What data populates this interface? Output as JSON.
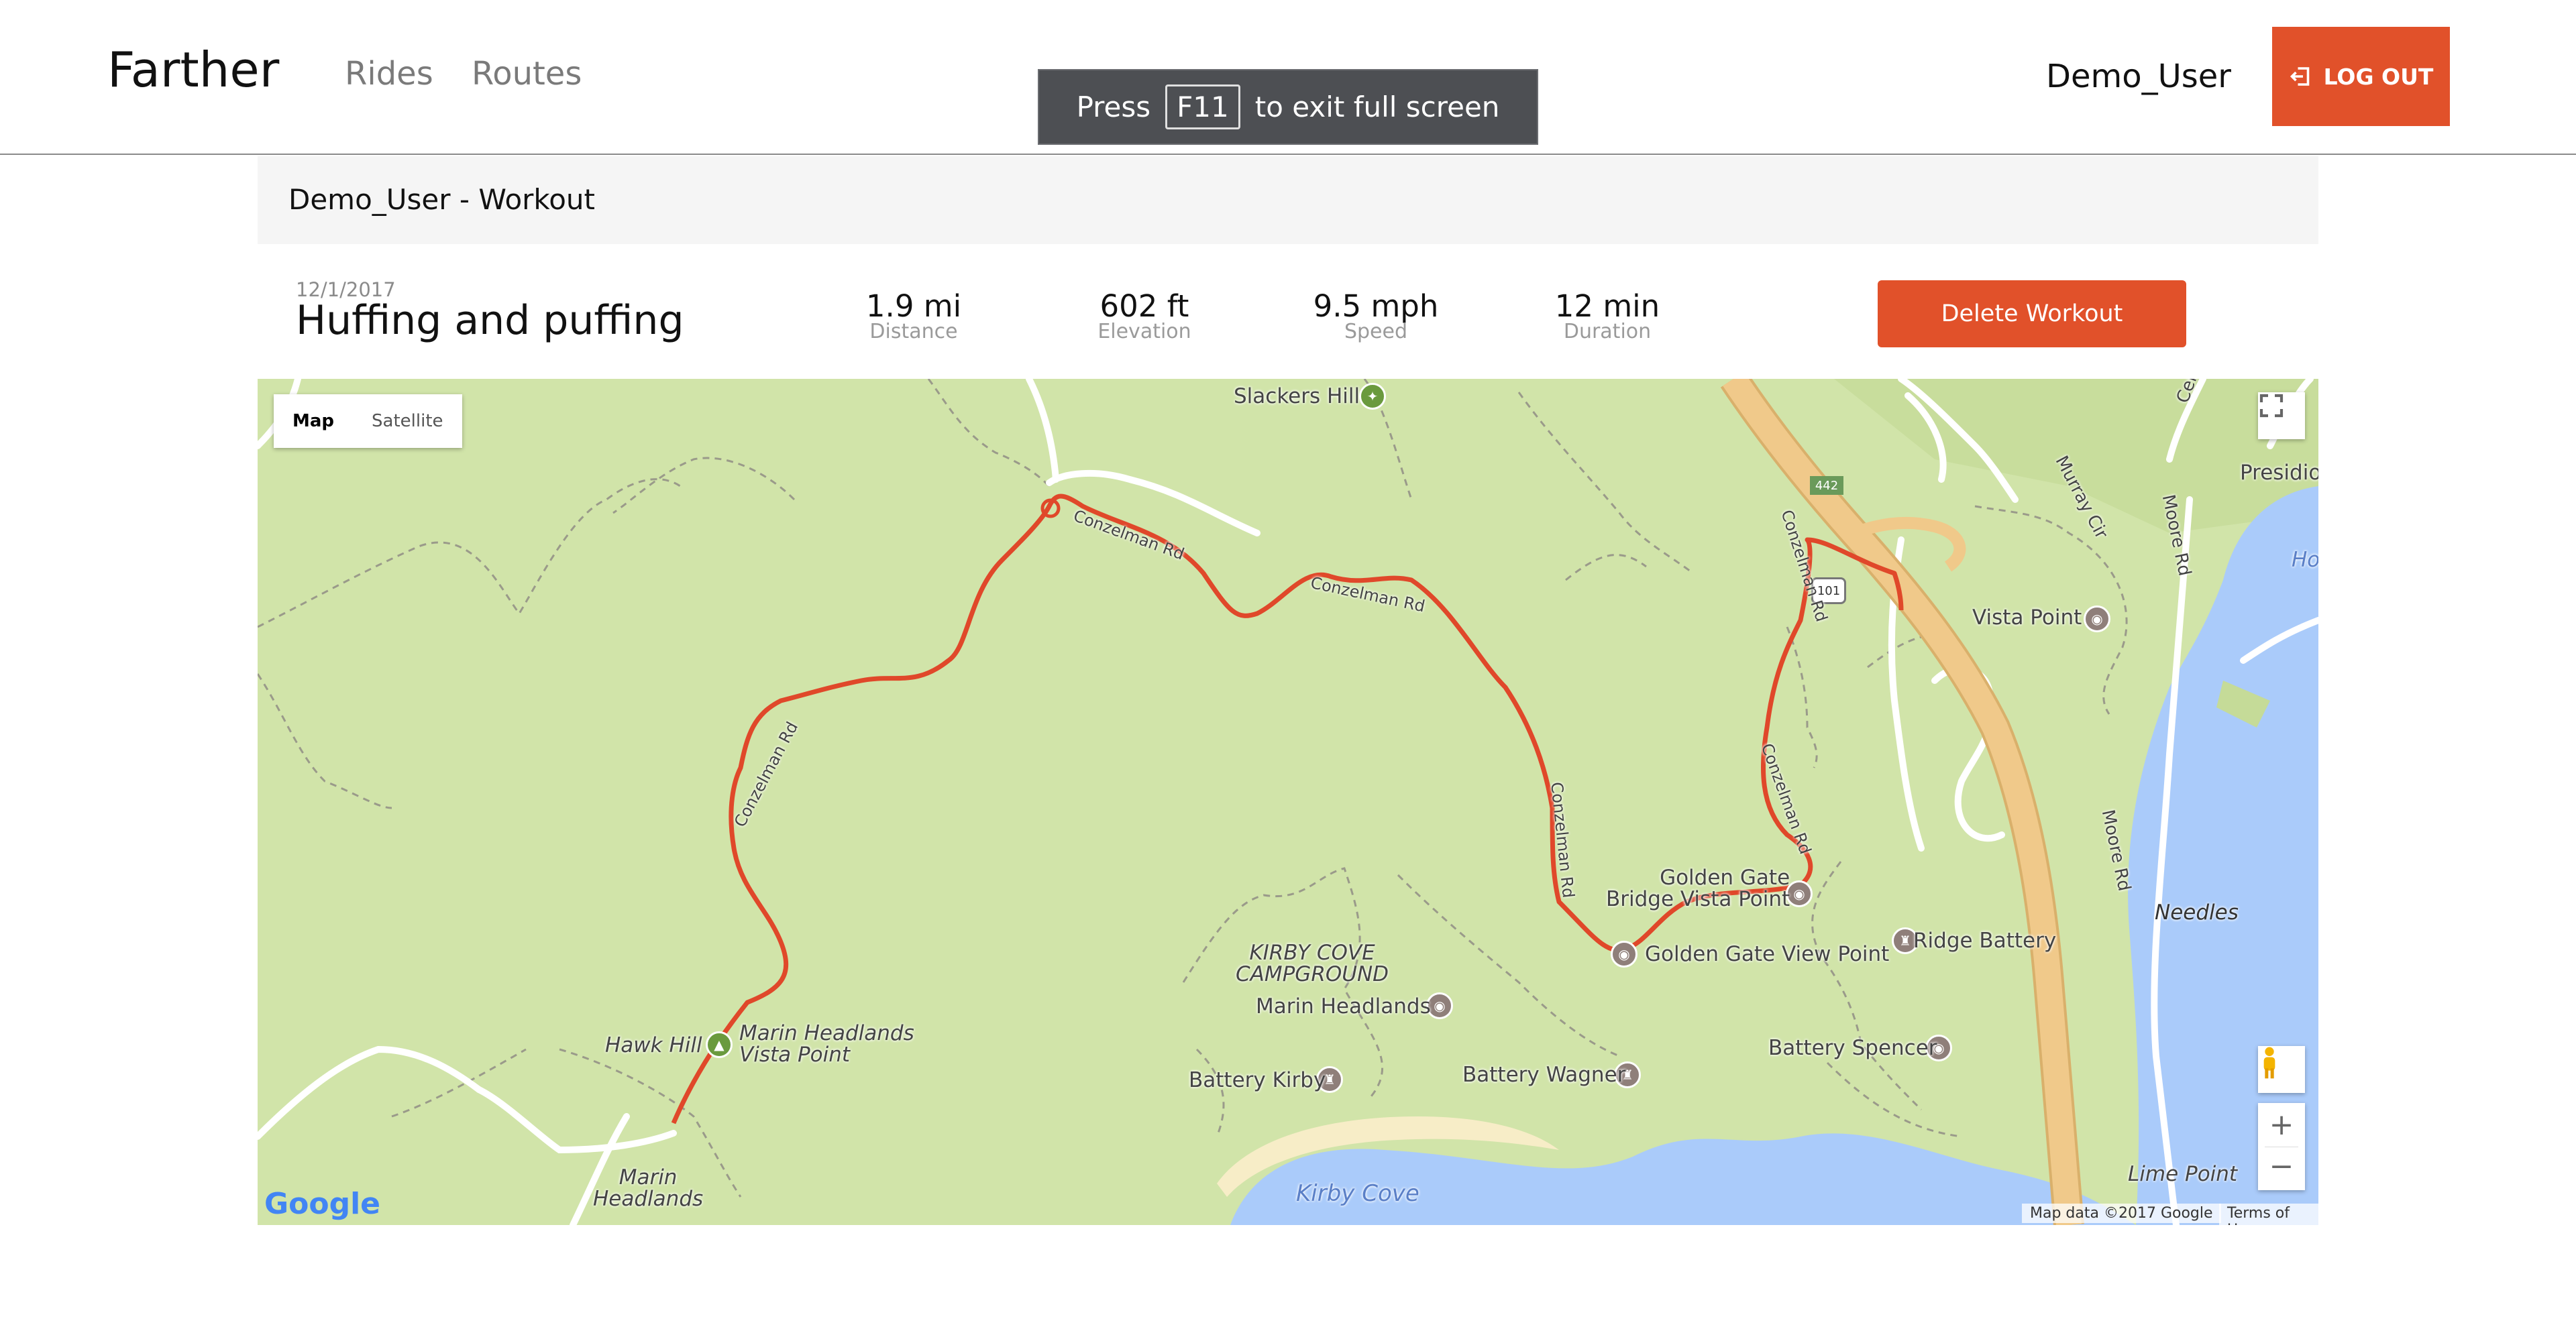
{
  "app": {
    "brand": "Farther"
  },
  "nav": {
    "rides": "Rides",
    "routes": "Routes"
  },
  "user": {
    "name": "Demo_User",
    "logout_label": "LOG OUT"
  },
  "fullscreen_toast": {
    "before": "Press",
    "key": "F11",
    "after": "to exit full screen"
  },
  "panel": {
    "heading": "Demo_User - Workout"
  },
  "workout": {
    "date": "12/1/2017",
    "title": "Huffing and puffing",
    "stats": [
      {
        "value": "1.9 mi",
        "label": "Distance"
      },
      {
        "value": "602 ft",
        "label": "Elevation"
      },
      {
        "value": "9.5 mph",
        "label": "Speed"
      },
      {
        "value": "12 min",
        "label": "Duration"
      }
    ],
    "delete_label": "Delete Workout"
  },
  "map": {
    "type_buttons": {
      "map": "Map",
      "satellite": "Satellite"
    },
    "labels": {
      "slackers_hill": "Slackers Hill",
      "vista_point": "Vista Point",
      "presidio": "Presidio Y",
      "ho": "Ho",
      "murray": "Murray Cir",
      "center": "Center Rd",
      "moore1": "Moore Rd",
      "moore2": "Moore Rd",
      "needles": "Needles",
      "golden_gate_bridge_vp": "Golden Gate\nBridge Vista Point",
      "golden_gate_view_point": "Golden Gate View Point",
      "ridge_battery": "Ridge Battery",
      "battery_spencer": "Battery Spencer",
      "kirby_cove_campground": "KIRBY COVE\nCAMPGROUND",
      "marin_headlands_poi": "Marin Headlands",
      "battery_kirby": "Battery Kirby",
      "battery_wagner": "Battery Wagner",
      "hawk_hill": "Hawk Hill",
      "marin_headlands_vista": "Marin Headlands\nVista Point",
      "marin_headlands_area": "Marin\nHeadlands",
      "kirby_cove": "Kirby Cove",
      "lime_point": "Lime Point",
      "conzelman": "Conzelman Rd",
      "shield_101": "101",
      "shield_442": "442"
    },
    "attribution": {
      "data": "Map data ©2017 Google",
      "terms": "Terms of Use",
      "logo": "Google"
    },
    "colors": {
      "route": "#e0482a",
      "land": "#d1e4a9",
      "water": "#aacbfa",
      "highway": "#f0c98a",
      "beach": "#f7edc7"
    }
  }
}
